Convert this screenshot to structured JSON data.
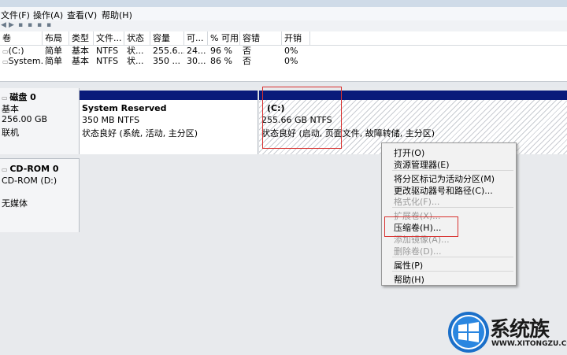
{
  "menu": [
    "文件(F)",
    "操作(A)",
    "查看(V)",
    "帮助(H)"
  ],
  "columns": [
    "卷",
    "布局",
    "类型",
    "文件...",
    "状态",
    "容量",
    "可...",
    "% 可用",
    "容错",
    "开销"
  ],
  "volumes": [
    {
      "name": "(C:)",
      "layout": "简单",
      "type": "基本",
      "fs": "NTFS",
      "status": "状...",
      "capacity": "255.6...",
      "free": "24...",
      "pct": "96 %",
      "fault": "否",
      "overhead": "0%"
    },
    {
      "name": "System...",
      "layout": "简单",
      "type": "基本",
      "fs": "NTFS",
      "status": "状...",
      "capacity": "350 ...",
      "free": "30...",
      "pct": "86 %",
      "fault": "否",
      "overhead": "0%"
    }
  ],
  "disk0": {
    "title": "磁盘 0",
    "type": "基本",
    "size": "256.00 GB",
    "state": "联机"
  },
  "partitions": [
    {
      "title": "System Reserved",
      "size": "350 MB NTFS",
      "status": "状态良好 (系统, 活动, 主分区)"
    },
    {
      "title": "(C:)",
      "size": "255.66 GB NTFS",
      "status": "状态良好 (启动, 页面文件, 故障转储, 主分区)"
    }
  ],
  "cdrom": {
    "title": "CD-ROM 0",
    "drive": "CD-ROM (D:)",
    "media": "无媒体"
  },
  "context_menu": [
    {
      "label": "打开(O)",
      "enabled": true
    },
    {
      "label": "资源管理器(E)",
      "enabled": true
    },
    {
      "label": "将分区标记为活动分区(M)",
      "enabled": true
    },
    {
      "label": "更改驱动器号和路径(C)...",
      "enabled": true
    },
    {
      "label": "格式化(F)...",
      "enabled": false
    },
    {
      "label": "扩展卷(X)...",
      "enabled": false
    },
    {
      "label": "压缩卷(H)...",
      "enabled": true
    },
    {
      "label": "添加镜像(A)...",
      "enabled": false
    },
    {
      "label": "删除卷(D)...",
      "enabled": false
    },
    {
      "label": "属性(P)",
      "enabled": true
    },
    {
      "label": "帮助(H)",
      "enabled": true
    }
  ],
  "watermark": {
    "brand": "系统族",
    "url": "WWW.XITONGZU.COM"
  },
  "colors": {
    "volume_bar": "#0a1a7a",
    "highlight_box": "#d8312f",
    "menu_bg": "#f2f2f2"
  }
}
